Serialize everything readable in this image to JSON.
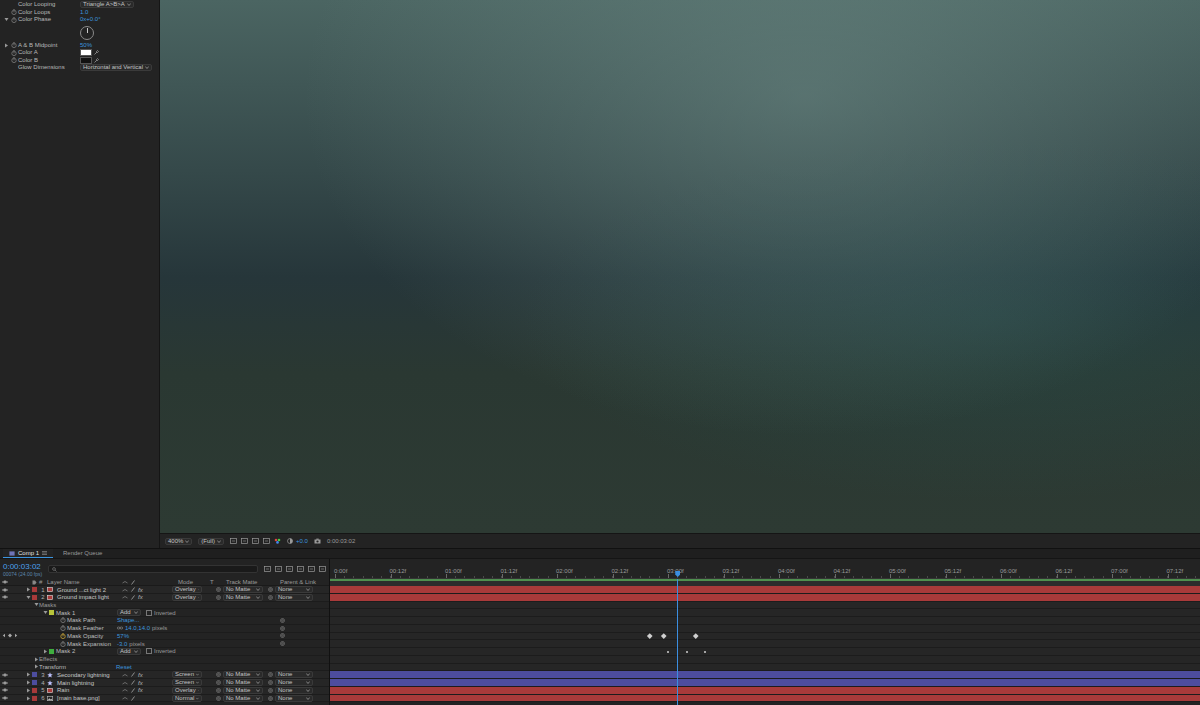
{
  "effect_controls": {
    "properties": [
      {
        "kind": "dropdown",
        "name": "Color Looping",
        "value": "Triangle A>B>A"
      },
      {
        "kind": "number",
        "name": "Color Loops",
        "value": "1.0"
      },
      {
        "kind": "angle",
        "name": "Color Phase",
        "value": "0x+0.0°",
        "expanded": true,
        "level": 0
      },
      {
        "kind": "number",
        "name": "A & B Midpoint",
        "value": "50%",
        "expanded": false
      },
      {
        "kind": "color",
        "name": "Color A",
        "color": "#ffffff"
      },
      {
        "kind": "color",
        "name": "Color B",
        "color": "#111111"
      },
      {
        "kind": "dropdown",
        "name": "Glow Dimensions",
        "value": "Horizontal and Vertical"
      }
    ]
  },
  "viewer": {
    "zoom": "400%",
    "resolution": "(Full)",
    "exposure": "+0.0",
    "time": "0:00:03:02"
  },
  "timeline": {
    "tabs": [
      {
        "label": "Comp 1",
        "selected": true
      },
      {
        "label": "Render Queue",
        "selected": false
      }
    ],
    "current_time": "0:00:03:02",
    "frame_info": "00074 (24.00 fps)",
    "columns": {
      "number": "#",
      "name": "Layer Name",
      "mode": "Mode",
      "t": "T",
      "track_matte": "Track Matte",
      "parent": "Parent & Link"
    },
    "ruler": [
      "0:00f",
      "00:12f",
      "01:00f",
      "01:12f",
      "02:00f",
      "02:12f",
      "03:00f",
      "03:12f",
      "04:00f",
      "04:12f",
      "05:00f",
      "05:12f",
      "06:00f",
      "06:12f",
      "07:00f",
      "07:12f"
    ],
    "current_frame": 74,
    "rows": [
      {
        "kind": "layer",
        "number": "1",
        "name": "Ground ...ct light 2",
        "color": "#a83a3a",
        "layer_type": "solid",
        "visible": true,
        "expanded": false,
        "fx": "fx",
        "mode": "Overlay",
        "track_matte": "No Matte",
        "parent": "None"
      },
      {
        "kind": "layer",
        "number": "2",
        "name": "Ground impact light",
        "color": "#a83a3a",
        "layer_type": "solid",
        "visible": true,
        "expanded": true,
        "fx": "fx",
        "mode": "Overlay",
        "track_matte": "No Matte",
        "parent": "None"
      },
      {
        "kind": "group",
        "name": "Masks",
        "expanded": true
      },
      {
        "kind": "mask",
        "name": "Mask 1",
        "color": "#b7c43a",
        "expanded": true,
        "mode": "Add",
        "inverted": false,
        "inverted_label": "Inverted",
        "keyframes": []
      },
      {
        "kind": "property",
        "name": "Mask Path",
        "value": "Shape...",
        "animated": false,
        "keyframes": []
      },
      {
        "kind": "property",
        "name": "Mask Feather",
        "value": "14.0,14.0",
        "unit": "pixels",
        "linked": true,
        "animated": false,
        "keyframes": []
      },
      {
        "kind": "property",
        "name": "Mask Opacity",
        "value": "57%",
        "animated": true,
        "keyframes": [
          68,
          71,
          78
        ]
      },
      {
        "kind": "property",
        "name": "Mask Expansion",
        "value": "-3.0",
        "unit": "pixels",
        "animated": false,
        "keyframes": []
      },
      {
        "kind": "mask",
        "name": "Mask 2",
        "color": "#3fae3f",
        "expanded": false,
        "mode": "Add",
        "inverted": false,
        "inverted_label": "Inverted",
        "keyframes": [
          72,
          76,
          80
        ]
      },
      {
        "kind": "group",
        "name": "Effects",
        "expanded": false
      },
      {
        "kind": "group",
        "name": "Transform",
        "expanded": false,
        "value": "Reset"
      },
      {
        "kind": "layer",
        "number": "3",
        "name": "Secondary lightning",
        "color": "#4d4d9e",
        "layer_type": "shape",
        "visible": true,
        "expanded": false,
        "fx": "fx",
        "mode": "Screen",
        "track_matte": "No Matte",
        "parent": "None"
      },
      {
        "kind": "layer",
        "number": "4",
        "name": "Main lightning",
        "color": "#4d4d9e",
        "layer_type": "shape",
        "visible": true,
        "expanded": false,
        "fx": "fx",
        "mode": "Screen",
        "track_matte": "No Matte",
        "parent": "None"
      },
      {
        "kind": "layer",
        "number": "5",
        "name": "Rain",
        "color": "#a83a3a",
        "layer_type": "solid",
        "visible": true,
        "expanded": false,
        "fx": "fx",
        "mode": "Overlay",
        "track_matte": "No Matte",
        "parent": "None"
      },
      {
        "kind": "layer",
        "number": "6",
        "name": "[main base.png]",
        "color": "#a83a3a",
        "layer_type": "footage",
        "visible": true,
        "expanded": false,
        "mode": "Normal",
        "track_matte": "No Matte",
        "parent": "None"
      }
    ]
  }
}
